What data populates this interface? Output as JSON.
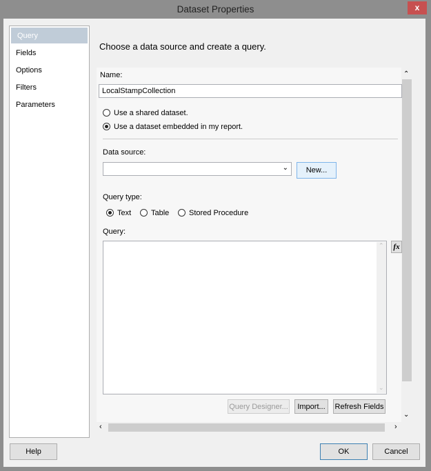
{
  "window": {
    "title": "Dataset Properties",
    "close_label": "x"
  },
  "nav": {
    "items": [
      {
        "label": "Query"
      },
      {
        "label": "Fields"
      },
      {
        "label": "Options"
      },
      {
        "label": "Filters"
      },
      {
        "label": "Parameters"
      }
    ]
  },
  "main": {
    "heading": "Choose a data source and create a query.",
    "name_label": "Name:",
    "name_value": "LocalStampCollection",
    "shared_option": "Use a shared dataset.",
    "embedded_option": "Use a dataset embedded in my report.",
    "datasource_label": "Data source:",
    "datasource_value": "",
    "new_button": "New...",
    "query_type_label": "Query type:",
    "query_types": [
      {
        "label": "Text",
        "selected": true
      },
      {
        "label": "Table"
      },
      {
        "label": "Stored Procedure"
      }
    ],
    "query_label": "Query:",
    "query_value": "",
    "fx_label": "fx",
    "query_designer_button": "Query Designer...",
    "import_button": "Import...",
    "refresh_button": "Refresh Fields"
  },
  "footer": {
    "help": "Help",
    "ok": "OK",
    "cancel": "Cancel"
  }
}
